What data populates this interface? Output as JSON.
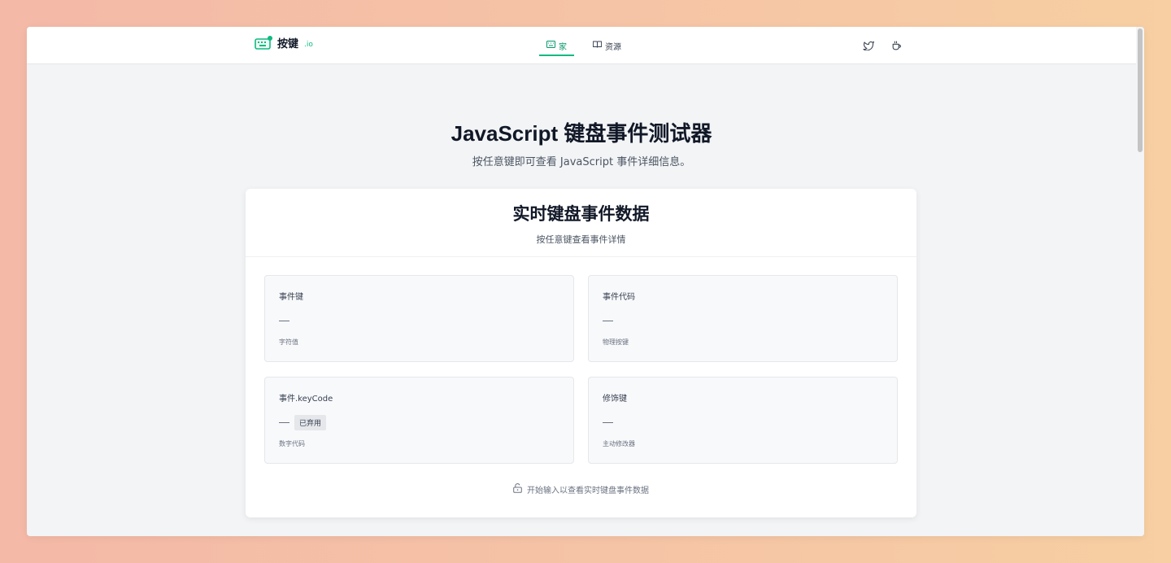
{
  "header": {
    "logo_text": "按键",
    "logo_sub": ".io",
    "nav": [
      {
        "label": "家",
        "icon": "keyboard-icon",
        "active": true
      },
      {
        "label": "资源",
        "icon": "book-icon",
        "active": false
      }
    ],
    "actions": [
      {
        "icon": "twitter-icon"
      },
      {
        "icon": "coffee-icon"
      }
    ]
  },
  "hero": {
    "title": "JavaScript 键盘事件测试器",
    "subtitle": "按任意键即可查看 JavaScript 事件详细信息。"
  },
  "card": {
    "title": "实时键盘事件数据",
    "subtitle": "按任意键查看事件详情",
    "tiles": [
      {
        "label": "事件键",
        "value": "",
        "badge": "",
        "desc": "字符值"
      },
      {
        "label": "事件代码",
        "value": "",
        "badge": "",
        "desc": "物理按键"
      },
      {
        "label": "事件.keyCode",
        "value": "",
        "badge": "已弃用",
        "desc": "数字代码"
      },
      {
        "label": "修饰键",
        "value": "",
        "badge": "",
        "desc": "主动修改器"
      }
    ],
    "hint": "开始输入以查看实时键盘事件数据"
  },
  "colors": {
    "accent": "#10b981",
    "background": "#f3f4f6"
  }
}
